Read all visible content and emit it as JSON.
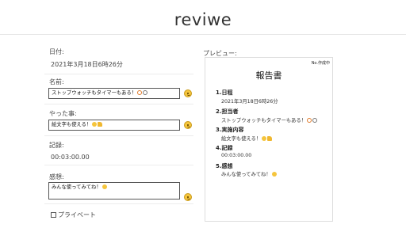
{
  "app": {
    "title": "reviwe"
  },
  "form": {
    "date": {
      "label": "日付:",
      "value": "2021年3月18日6時26分"
    },
    "name": {
      "label": "名前:",
      "value": "ストップウォッチもタイマーもある！"
    },
    "done": {
      "label": "やった事:",
      "value": "絵文字も使える！"
    },
    "record": {
      "label": "記録:",
      "value": "00:03:00.00"
    },
    "impression": {
      "label": "感想:",
      "value": "みんな使ってみてね！"
    },
    "private": {
      "label": "プライベート",
      "checked": false
    }
  },
  "preview": {
    "label": "プレビュー:",
    "status": "No.作成中",
    "title": "報告書",
    "sections": [
      {
        "heading": "1.日程",
        "value": "2021年3月18日6時26分"
      },
      {
        "heading": "2.担当者",
        "value": "ストップウォッチもタイマーもある！"
      },
      {
        "heading": "3.実施内容",
        "value": "絵文字も使える！"
      },
      {
        "heading": "4.記録",
        "value": "00:03:00.00"
      },
      {
        "heading": "5.感想",
        "value": "みんな使ってみてね！"
      }
    ]
  },
  "icons": {
    "emoji_picker": "smiley-face-icon",
    "alarm": "alarm-clock-icon",
    "stopwatch": "stopwatch-icon",
    "grin": "grinning-face-icon",
    "thumbs": "thumbs-up-icon",
    "smile": "smiling-face-icon"
  },
  "colors": {
    "emoji_yellow": "#f5c53d",
    "border": "#555555"
  }
}
